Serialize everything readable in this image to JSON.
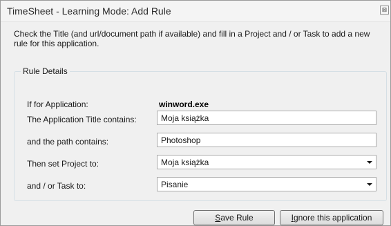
{
  "window": {
    "title": "TimeSheet - Learning Mode: Add Rule",
    "close_glyph": "⊠",
    "close_icon": "close-icon"
  },
  "instructions": "Check the Title (and url/document path if available) and fill in a Project and / or Task to add a new  rule for this application.",
  "rule_details": {
    "legend": "Rule Details",
    "application_label": "If for Application:",
    "application_value": "winword.exe",
    "title_label": "The Application Title contains:",
    "title_value": "Moja książka",
    "path_label": "and the path contains:",
    "path_value": "Photoshop",
    "project_label": "Then set Project to:",
    "project_value": "Moja książka",
    "task_label": "and / or Task to:",
    "task_value": "Pisanie"
  },
  "buttons": {
    "save_mnemonic": "S",
    "save_rest": "ave Rule",
    "ignore_mnemonic": "I",
    "ignore_rest": "gnore this application"
  }
}
